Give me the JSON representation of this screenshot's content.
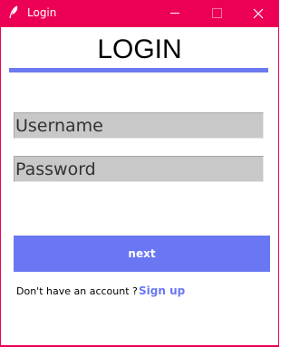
{
  "window": {
    "title": "Login",
    "icon": "feather-icon",
    "controls": [
      "minimize-icon",
      "maximize-icon",
      "close-icon"
    ],
    "titlebar_color": "#ec0055"
  },
  "form": {
    "heading": "LOGIN",
    "accent_color": "#6a77f3",
    "username_placeholder": "Username",
    "password_placeholder": "Password",
    "next_label": "next",
    "signup_prompt": "Don't have an account ?",
    "signup_link": "Sign up"
  }
}
